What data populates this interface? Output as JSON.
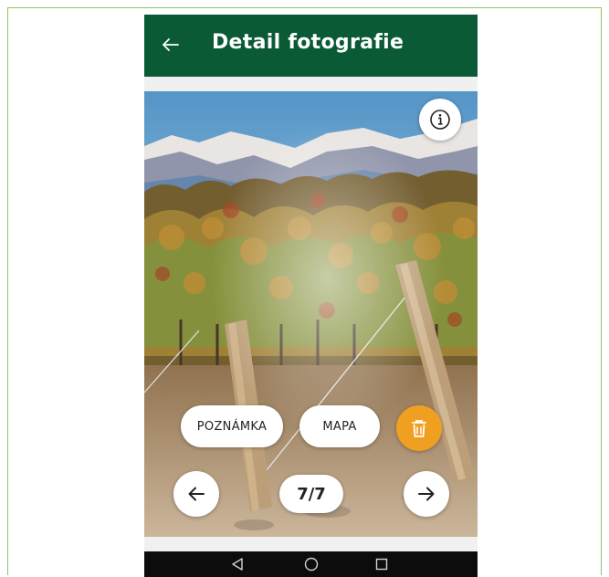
{
  "appbar": {
    "title": "Detail fotografie",
    "back_icon": "arrow-left-icon"
  },
  "photo": {
    "subject": "vineyard-with-mountains",
    "info_icon": "info-icon"
  },
  "actions": {
    "note_label": "POZNÁMKA",
    "map_label": "MAPA",
    "delete_icon": "trash-icon",
    "delete_color": "#f0a020"
  },
  "pager": {
    "counter": "7/7",
    "prev_icon": "arrow-left-icon",
    "next_icon": "arrow-right-icon"
  },
  "navbar": {
    "back_icon": "triangle-back-icon",
    "home_icon": "circle-home-icon",
    "recent_icon": "square-recents-icon"
  },
  "colors": {
    "appbar": "#0a5a35",
    "accent": "#f0a020",
    "navbar": "#0c0c0c"
  }
}
